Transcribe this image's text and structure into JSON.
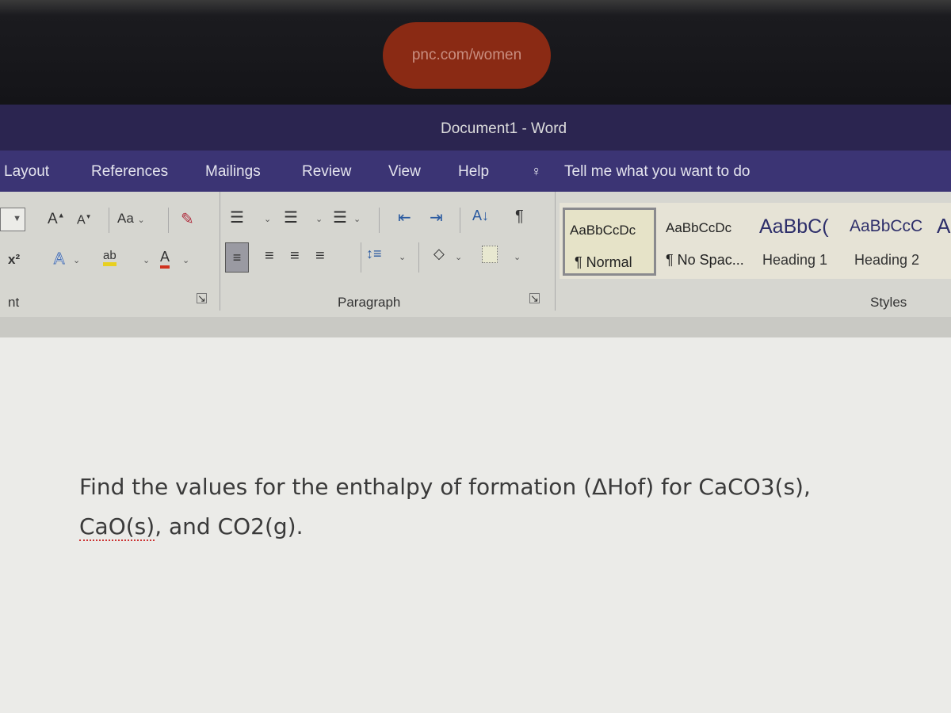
{
  "browser": {
    "url_pill": "pnc.com/women"
  },
  "window": {
    "title": "Document1  -  Word"
  },
  "tabs": [
    {
      "label": "Layout"
    },
    {
      "label": "References"
    },
    {
      "label": "Mailings"
    },
    {
      "label": "Review"
    },
    {
      "label": "View"
    },
    {
      "label": "Help"
    }
  ],
  "tell_me": {
    "placeholder": "Tell me what you want to do"
  },
  "font_group": {
    "label": "nt",
    "change_case": "Aa",
    "superscript": "x²"
  },
  "paragraph_group": {
    "label": "Paragraph"
  },
  "styles_group": {
    "label": "Styles",
    "items": [
      {
        "preview": "AaBbCcDc",
        "label": "¶ Normal",
        "selected": true
      },
      {
        "preview": "AaBbCcDc",
        "label": "¶ No Spac..."
      },
      {
        "preview": "AaBbC(",
        "label": "Heading 1"
      },
      {
        "preview": "AaBbCcC",
        "label": "Heading 2"
      }
    ]
  },
  "document": {
    "line1": "Find the values for the enthalpy of formation (ΔHof) for CaCO3(s),",
    "line2_a": "CaO(s)",
    "line2_b": ", and CO2(g)."
  },
  "colors": {
    "accent": "#3b3474",
    "title_bar": "#2b2550",
    "highlight": "#e8d020",
    "font_color": "#d0321e"
  }
}
